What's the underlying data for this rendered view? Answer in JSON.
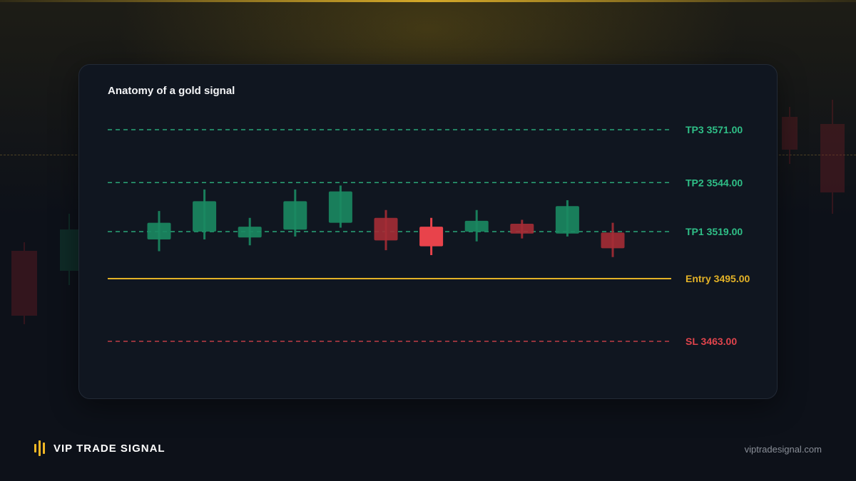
{
  "chart_data": {
    "type": "candlestick",
    "title": "Anatomy of a gold signal",
    "ylim": [
      3445,
      3590
    ],
    "colors": {
      "take_profit": "#2fbf87",
      "entry": "#e3b227",
      "stop_loss": "#e0444c",
      "bull": "#1b8a62",
      "bear": "#a52c35",
      "bear_highlight": "#e8434b"
    },
    "levels": [
      {
        "label": "TP3 3571.00",
        "value": 3571.0,
        "kind": "take_profit",
        "style": "dashed"
      },
      {
        "label": "TP2 3544.00",
        "value": 3544.0,
        "kind": "take_profit",
        "style": "dashed"
      },
      {
        "label": "TP1 3519.00",
        "value": 3519.0,
        "kind": "take_profit",
        "style": "dashed"
      },
      {
        "label": "Entry 3495.00",
        "value": 3495.0,
        "kind": "entry",
        "style": "solid"
      },
      {
        "label": "SL 3463.00",
        "value": 3463.0,
        "kind": "stop_loss",
        "style": "dashed"
      }
    ],
    "candles": [
      {
        "open": 3515.0,
        "close": 3523.5,
        "high": 3529.5,
        "low": 3509.0
      },
      {
        "open": 3519.0,
        "close": 3534.5,
        "high": 3540.5,
        "low": 3515.0
      },
      {
        "open": 3516.0,
        "close": 3521.5,
        "high": 3526.0,
        "low": 3512.0
      },
      {
        "open": 3520.0,
        "close": 3534.5,
        "high": 3540.5,
        "low": 3516.5
      },
      {
        "open": 3523.5,
        "close": 3539.5,
        "high": 3542.5,
        "low": 3521.0
      },
      {
        "open": 3526.0,
        "close": 3514.5,
        "high": 3530.0,
        "low": 3509.5
      },
      {
        "open": 3521.5,
        "close": 3511.5,
        "high": 3526.0,
        "low": 3507.0
      },
      {
        "open": 3519.0,
        "close": 3524.5,
        "high": 3530.0,
        "low": 3514.0
      },
      {
        "open": 3523.0,
        "close": 3518.0,
        "high": 3525.0,
        "low": 3515.5
      },
      {
        "open": 3518.0,
        "close": 3532.0,
        "high": 3535.0,
        "low": 3516.5
      },
      {
        "open": 3518.5,
        "close": 3510.5,
        "high": 3523.5,
        "low": 3506.0
      }
    ],
    "highlight_index": 6,
    "grid": false,
    "legend": "none"
  },
  "brand": {
    "name": "VIP TRADE SIGNAL",
    "logo_icon": "bars-logo-icon",
    "accent": "#f1b825"
  },
  "footer": {
    "site": "viptradesignal.com"
  }
}
